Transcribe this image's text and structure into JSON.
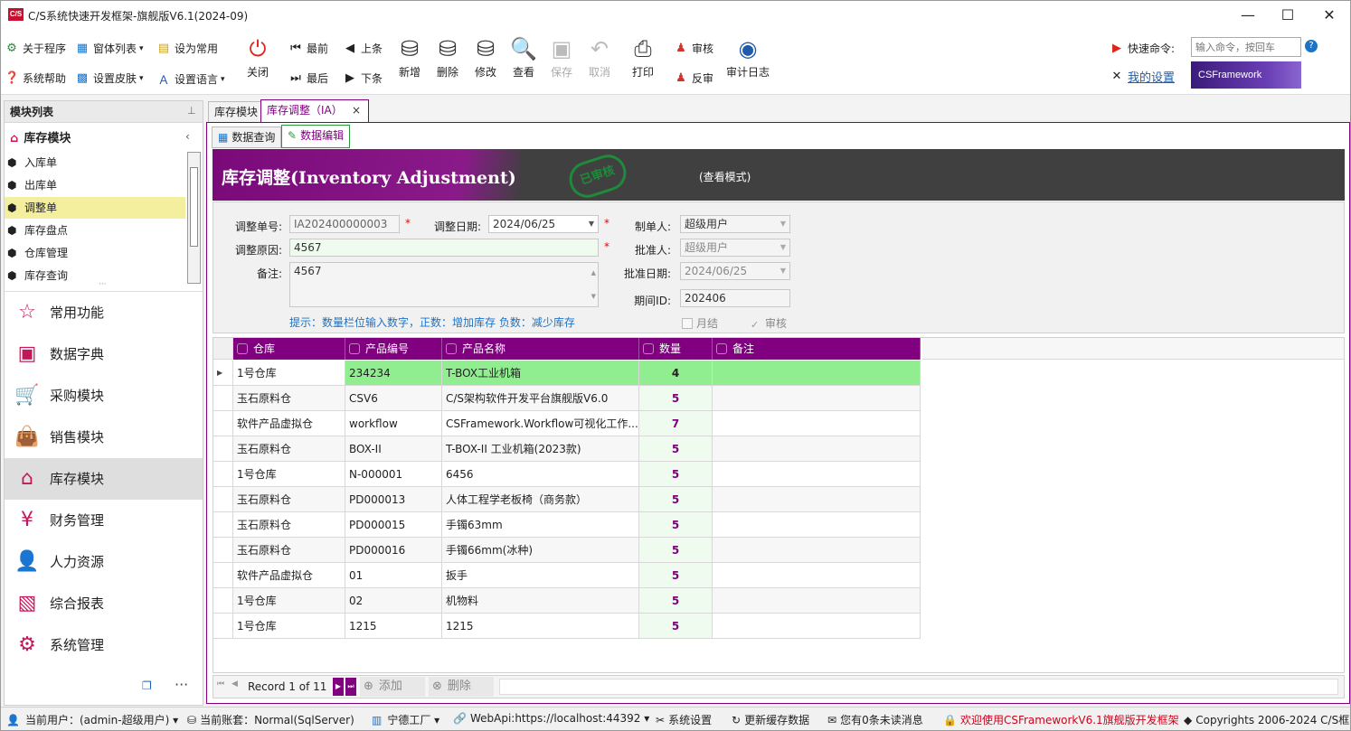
{
  "window": {
    "title": "C/S系统快速开发框架-旗舰版V6.1(2024-09)",
    "logo": "C/S",
    "minimize": "—",
    "maximize": "☐",
    "close": "✕"
  },
  "ribbon": {
    "about": "关于程序",
    "window_list": "窗体列表",
    "set_common": "设为常用",
    "help": "系统帮助",
    "skin": "设置皮肤",
    "language": "设置语言",
    "close": "关闭",
    "first": "最前",
    "prev": "上条",
    "last": "最后",
    "next": "下条",
    "add": "新增",
    "delete": "删除",
    "edit": "修改",
    "view": "查看",
    "save": "保存",
    "cancel": "取消",
    "print": "打印",
    "audit": "审核",
    "unaudit": "反审",
    "audit_log": "审计日志",
    "quick_cmd_label": "快速命令:",
    "quick_cmd_placeholder": "输入命令，按回车",
    "my_settings": "我的设置",
    "brand": "CSFramework"
  },
  "left": {
    "header": "模块列表",
    "pin": "ᵖ",
    "group": "库存模块",
    "tree": [
      "入库单",
      "出库单",
      "调整单",
      "库存盘点",
      "仓库管理",
      "库存查询"
    ],
    "tree_selected": 2,
    "nav": [
      "常用功能",
      "数据字典",
      "采购模块",
      "销售模块",
      "库存模块",
      "财务管理",
      "人力资源",
      "综合报表",
      "系统管理"
    ],
    "nav_selected": 4
  },
  "tabs": {
    "doc": [
      "库存模块",
      "库存调整（IA）"
    ],
    "sub": [
      "数据查询",
      "数据编辑"
    ]
  },
  "banner": {
    "title": "库存调整(Inventory Adjustment)",
    "stamp": "已审核",
    "mode": "(查看模式)"
  },
  "form": {
    "doc_no_label": "调整单号:",
    "doc_no": "IA202400000003",
    "date_label": "调整日期:",
    "date": "2024/06/25",
    "creator_label": "制单人:",
    "creator": "超级用户",
    "reason_label": "调整原因:",
    "reason": "4567",
    "approver_label": "批准人:",
    "approver": "超级用户",
    "remark_label": "备注:",
    "remark": "4567",
    "approve_date_label": "批准日期:",
    "approve_date": "2024/06/25",
    "period_label": "期间ID:",
    "period": "202406",
    "hint": "提示：数量栏位输入数字，正数：增加库存 负数：减少库存",
    "monthly": "月结",
    "audited": "审核",
    "req": "*"
  },
  "grid": {
    "columns": [
      "仓库",
      "产品编号",
      "产品名称",
      "数量",
      "备注"
    ],
    "rows": [
      [
        "1号仓库",
        "234234",
        "T-BOX工业机箱",
        "4",
        ""
      ],
      [
        "玉石原料仓",
        "CSV6",
        "C/S架构软件开发平台旗舰版V6.0",
        "5",
        ""
      ],
      [
        "软件产品虚拟仓",
        "workflow",
        "CSFramework.Workflow可视化工作...",
        "7",
        ""
      ],
      [
        "玉石原料仓",
        "BOX-II",
        "T-BOX-II 工业机箱(2023款)",
        "5",
        ""
      ],
      [
        "1号仓库",
        "N-000001",
        "6456",
        "5",
        ""
      ],
      [
        "玉石原料仓",
        "PD000013",
        "人体工程学老板椅（商务款）",
        "5",
        ""
      ],
      [
        "玉石原料仓",
        "PD000015",
        "手镯63mm",
        "5",
        ""
      ],
      [
        "玉石原料仓",
        "PD000016",
        "手镯66mm(冰种)",
        "5",
        ""
      ],
      [
        "软件产品虚拟仓",
        "01",
        "扳手",
        "5",
        ""
      ],
      [
        "1号仓库",
        "02",
        "机物料",
        "5",
        ""
      ],
      [
        "1号仓库",
        "1215",
        "1215",
        "5",
        ""
      ]
    ]
  },
  "navbar": {
    "record": "Record 1 of 11",
    "add": "添加",
    "delete": "删除"
  },
  "status": {
    "user": "当前用户：(admin-超级用户)",
    "account": "当前账套：Normal(SqlServer)",
    "factory": "宁德工厂",
    "webapi": "WebApi:https://localhost:44392",
    "settings": "系统设置",
    "refresh": "更新缓存数据",
    "messages": "您有0条未读消息",
    "welcome": "欢迎使用CSFrameworkV6.1旗舰版开发框架",
    "copyright": "Copyrights 2006-2024 C/S框"
  },
  "colors": {
    "accent": "#800080",
    "selected_row": "#90ee90",
    "banner": "#404040"
  }
}
